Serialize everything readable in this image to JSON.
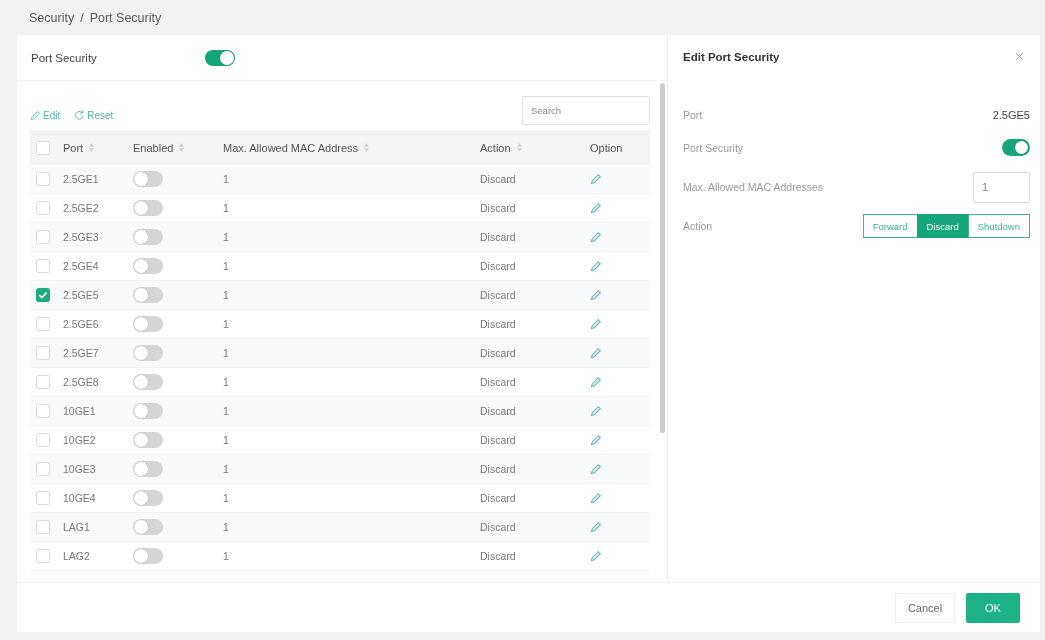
{
  "breadcrumb": {
    "items": [
      "Security",
      "Port Security"
    ],
    "separator": "/"
  },
  "port_security": {
    "label": "Port Security",
    "on": true
  },
  "toolbar": {
    "buttons": [
      {
        "kind": "edit",
        "label": "Edit"
      },
      {
        "kind": "reset",
        "label": "Reset"
      }
    ],
    "search": {
      "placeholder": "Search"
    }
  },
  "table": {
    "select_all": {
      "checked": false
    },
    "columns": [
      {
        "label": "Port",
        "sortable": true
      },
      {
        "label": "Enabled",
        "sortable": true
      },
      {
        "label": "Max. Allowed MAC Address",
        "sortable": true
      },
      {
        "label": "Action",
        "sortable": true
      },
      {
        "label": "Option",
        "sortable": false
      }
    ],
    "rows": [
      {
        "checked": false,
        "port": "2.5GE1",
        "enabled": false,
        "max_allowed_mac": "1",
        "action": "Discard"
      },
      {
        "checked": false,
        "port": "2.5GE2",
        "enabled": false,
        "max_allowed_mac": "1",
        "action": "Discard"
      },
      {
        "checked": false,
        "port": "2.5GE3",
        "enabled": false,
        "max_allowed_mac": "1",
        "action": "Discard"
      },
      {
        "checked": false,
        "port": "2.5GE4",
        "enabled": false,
        "max_allowed_mac": "1",
        "action": "Discard"
      },
      {
        "checked": true,
        "port": "2.5GE5",
        "enabled": false,
        "max_allowed_mac": "1",
        "action": "Discard"
      },
      {
        "checked": false,
        "port": "2.5GE6",
        "enabled": false,
        "max_allowed_mac": "1",
        "action": "Discard"
      },
      {
        "checked": false,
        "port": "2.5GE7",
        "enabled": false,
        "max_allowed_mac": "1",
        "action": "Discard"
      },
      {
        "checked": false,
        "port": "2.5GE8",
        "enabled": false,
        "max_allowed_mac": "1",
        "action": "Discard"
      },
      {
        "checked": false,
        "port": "10GE1",
        "enabled": false,
        "max_allowed_mac": "1",
        "action": "Discard"
      },
      {
        "checked": false,
        "port": "10GE2",
        "enabled": false,
        "max_allowed_mac": "1",
        "action": "Discard"
      },
      {
        "checked": false,
        "port": "10GE3",
        "enabled": false,
        "max_allowed_mac": "1",
        "action": "Discard"
      },
      {
        "checked": false,
        "port": "10GE4",
        "enabled": false,
        "max_allowed_mac": "1",
        "action": "Discard"
      },
      {
        "checked": false,
        "port": "LAG1",
        "enabled": false,
        "max_allowed_mac": "1",
        "action": "Discard"
      },
      {
        "checked": false,
        "port": "LAG2",
        "enabled": false,
        "max_allowed_mac": "1",
        "action": "Discard"
      }
    ]
  },
  "edit_panel": {
    "title": "Edit Port Security",
    "fields": [
      {
        "kind": "text",
        "label": "Port",
        "value": "2.5GE5"
      },
      {
        "kind": "toggle",
        "label": "Port Security",
        "on": true
      },
      {
        "kind": "input",
        "label": "Max. Allowed MAC Addresses",
        "value": "1"
      },
      {
        "kind": "segmented",
        "label": "Action",
        "options": [
          {
            "label": "Forward",
            "selected": false
          },
          {
            "label": "Discard",
            "selected": true
          },
          {
            "label": "Shutdown",
            "selected": false
          }
        ]
      }
    ]
  },
  "footer": {
    "buttons": [
      {
        "kind": "secondary",
        "label": "Cancel"
      },
      {
        "kind": "primary",
        "label": "OK"
      }
    ]
  }
}
